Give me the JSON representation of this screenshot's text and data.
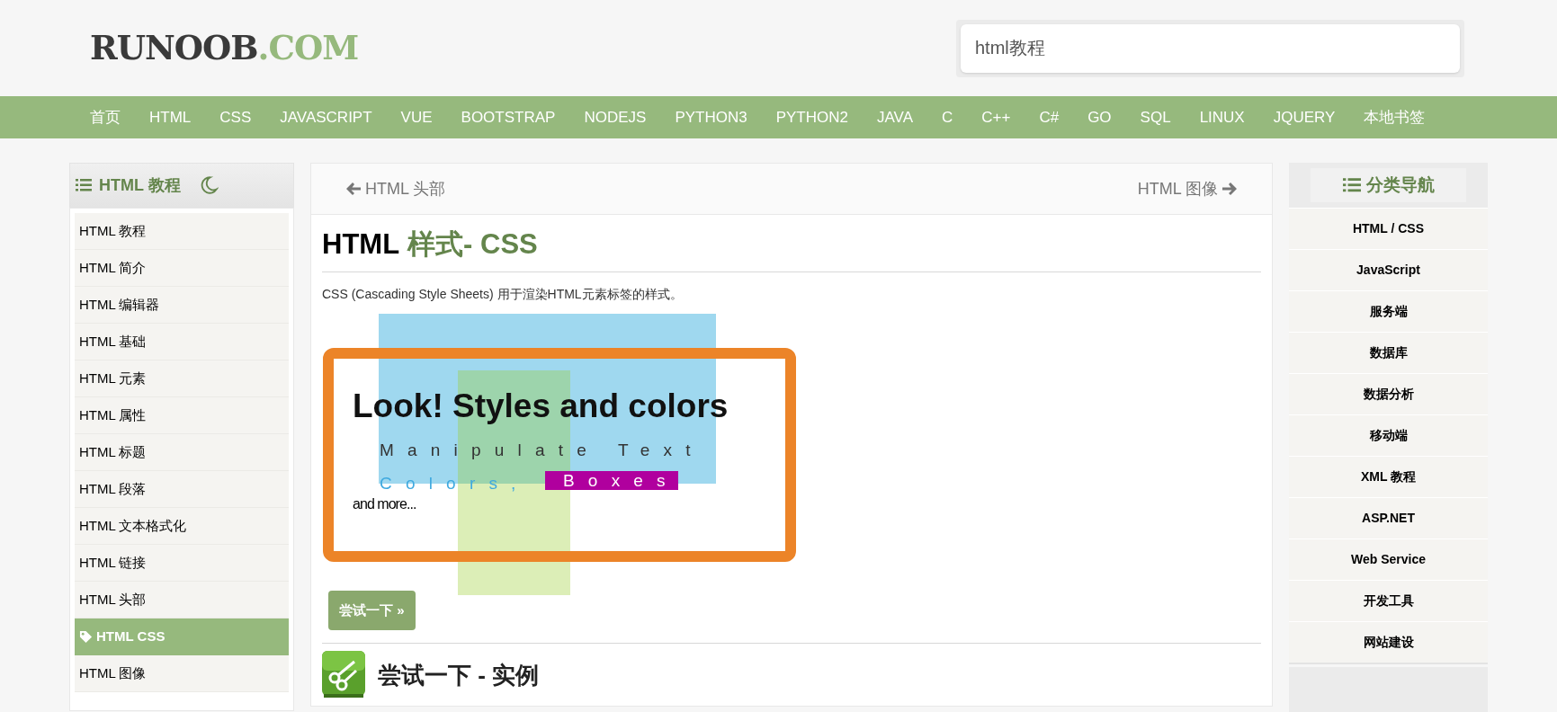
{
  "logo": {
    "text_1": "RUNOOB",
    "text_2": ".COM"
  },
  "search": {
    "value": "html教程"
  },
  "nav": [
    "首页",
    "HTML",
    "CSS",
    "JAVASCRIPT",
    "VUE",
    "BOOTSTRAP",
    "NODEJS",
    "PYTHON3",
    "PYTHON2",
    "JAVA",
    "C",
    "C++",
    "C#",
    "GO",
    "SQL",
    "LINUX",
    "JQUERY",
    "本地书签"
  ],
  "sidebar": {
    "title": "HTML 教程",
    "items": [
      {
        "label": "HTML 教程",
        "selected": false
      },
      {
        "label": "HTML 简介",
        "selected": false
      },
      {
        "label": "HTML 编辑器",
        "selected": false
      },
      {
        "label": "HTML 基础",
        "selected": false
      },
      {
        "label": "HTML 元素",
        "selected": false
      },
      {
        "label": "HTML 属性",
        "selected": false
      },
      {
        "label": "HTML 标题",
        "selected": false
      },
      {
        "label": "HTML 段落",
        "selected": false
      },
      {
        "label": "HTML 文本格式化",
        "selected": false
      },
      {
        "label": "HTML 链接",
        "selected": false
      },
      {
        "label": "HTML 头部",
        "selected": false
      },
      {
        "label": "HTML CSS",
        "selected": true
      },
      {
        "label": "HTML 图像",
        "selected": false
      }
    ]
  },
  "pager": {
    "previous": "HTML 头部",
    "next": "HTML 图像"
  },
  "article": {
    "title_1": "HTML",
    "title_2": "样式- CSS",
    "intro": "CSS (Cascading Style Sheets) 用于渲染HTML元素标签的样式。",
    "demo": {
      "heading": "Look! Styles and colors",
      "line_1": "Manipulate Text",
      "line_2a": "Colors,",
      "line_2b": "Boxes",
      "line_3": "and more..."
    },
    "try_button": "尝试一下 »",
    "example_heading": "尝试一下 - 实例"
  },
  "category_nav": {
    "title": "分类导航",
    "items": [
      "HTML / CSS",
      "JavaScript",
      "服务端",
      "数据库",
      "数据分析",
      "移动端",
      "XML 教程",
      "ASP.NET",
      "Web Service",
      "开发工具",
      "网站建设"
    ]
  }
}
